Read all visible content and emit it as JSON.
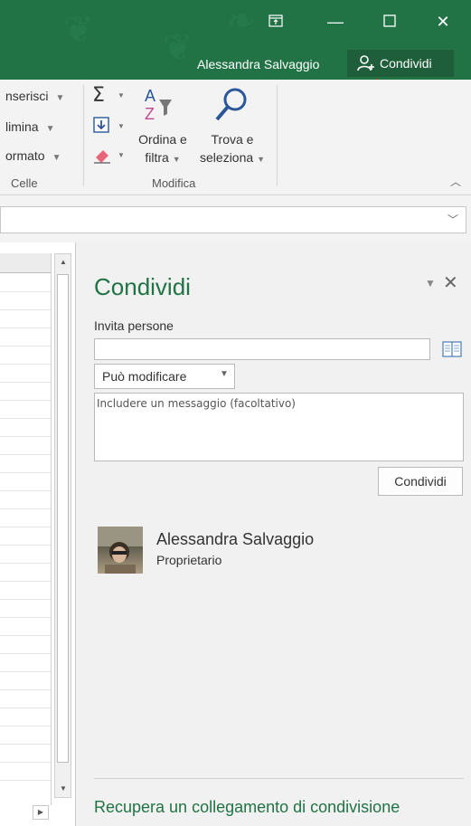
{
  "window": {
    "user_name": "Alessandra Salvaggio",
    "share_button_label": "Condividi",
    "controls": [
      "ribbon-display-icon",
      "minimize-icon",
      "maximize-icon",
      "close-icon"
    ],
    "accent_color": "#217346"
  },
  "ribbon": {
    "cells_group": {
      "items": [
        "nserisci",
        "limina",
        "ormato"
      ],
      "label": "Celle"
    },
    "edit_group": {
      "sort_filter_label_1": "Ordina e",
      "sort_filter_label_2": "filtra",
      "find_select_label_1": "Trova e",
      "find_select_label_2": "seleziona",
      "label": "Modifica"
    }
  },
  "share_pane": {
    "title": "Condividi",
    "invite_label": "Invita persone",
    "invite_value": "",
    "permission": "Può modificare",
    "message_placeholder": "Includere un messaggio (facoltativo)",
    "submit_label": "Condividi",
    "owner_name": "Alessandra Salvaggio",
    "owner_role": "Proprietario",
    "recover_link": "Recupera un collegamento di condivisione"
  }
}
